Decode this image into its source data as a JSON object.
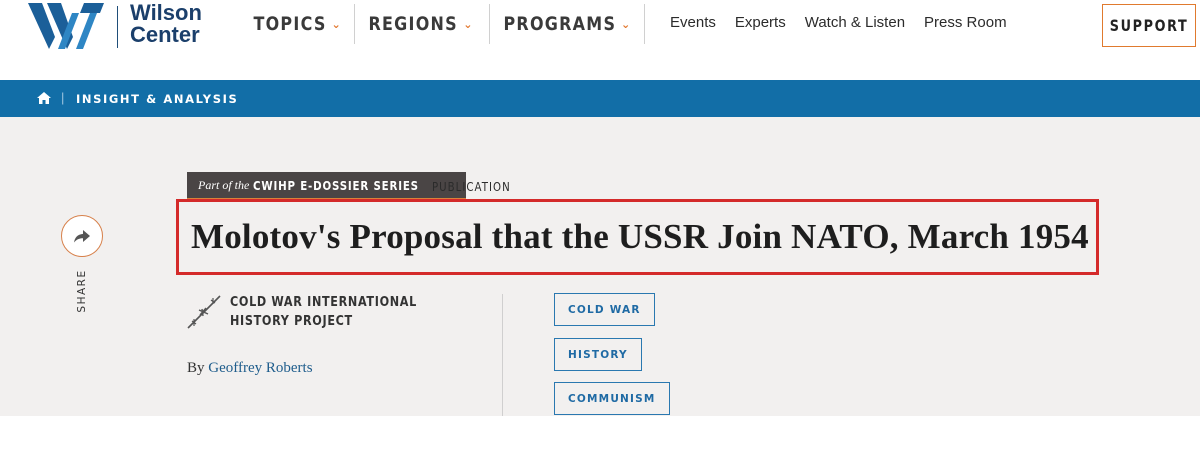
{
  "header": {
    "logo": {
      "line1": "Wilson",
      "line2": "Center",
      "mark": "W"
    },
    "main_nav": [
      {
        "label": "TOPICS"
      },
      {
        "label": "REGIONS"
      },
      {
        "label": "PROGRAMS"
      }
    ],
    "secondary_nav": [
      "Events",
      "Experts",
      "Watch & Listen",
      "Press Room"
    ],
    "support_label": "SUPPORT"
  },
  "breadcrumb": {
    "home_icon": "home-icon",
    "separator": "|",
    "item": "INSIGHT & ANALYSIS"
  },
  "article": {
    "series_prefix": "Part of the",
    "series_name": "CWIHP E-DOSSIER SERIES",
    "type": "PUBLICATION",
    "title": "Molotov's Proposal that the USSR Join NATO, March 1954",
    "program": "COLD WAR INTERNATIONAL HISTORY PROJECT",
    "byline_prefix": "By",
    "author": "Geoffrey Roberts",
    "tags": [
      "COLD WAR",
      "HISTORY",
      "COMMUNISM"
    ]
  },
  "share": {
    "label": "SHARE",
    "icon": "share-arrow-icon"
  },
  "colors": {
    "brand_blue": "#126ea7",
    "accent_orange": "#e2752a",
    "highlight_red": "#d42a2a",
    "hero_bg": "#f2f0ef",
    "series_tag_bg": "#4a4545"
  }
}
